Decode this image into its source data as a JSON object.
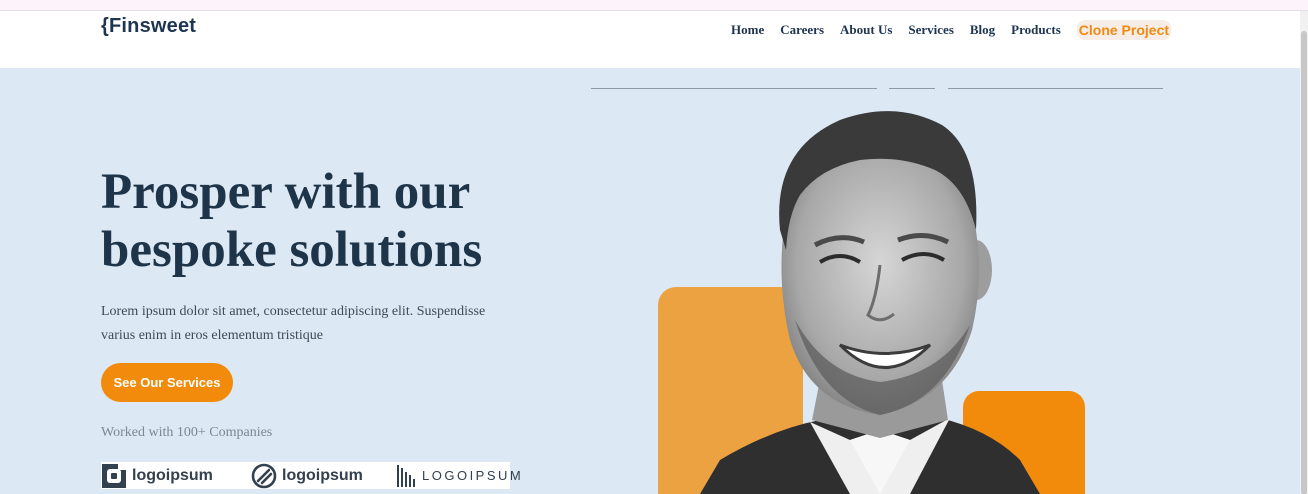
{
  "header": {
    "logo": "{Finsweet",
    "nav": [
      "Home",
      "Careers",
      "About Us",
      "Services",
      "Blog",
      "Products"
    ],
    "clone_project": "Clone Project"
  },
  "hero": {
    "title": "Prosper with our bespoke solutions",
    "description": "Lorem ipsum dolor sit amet, consectetur adipiscing elit. Suspendisse varius enim in eros elementum tristique",
    "cta_label": "See Our Services",
    "worked_with": "Worked with 100+ Companies"
  },
  "logos": [
    {
      "text": "logoipsum",
      "icon": "square-logo-icon"
    },
    {
      "text": "logoipsum",
      "icon": "circle-slash-logo-icon"
    },
    {
      "text": "LOGOIPSUM",
      "icon": "bars-logo-icon"
    }
  ],
  "colors": {
    "accent": "#f28b0c",
    "accent_soft": "#eda242",
    "navy": "#1e3448",
    "background": "#dce8f4"
  }
}
